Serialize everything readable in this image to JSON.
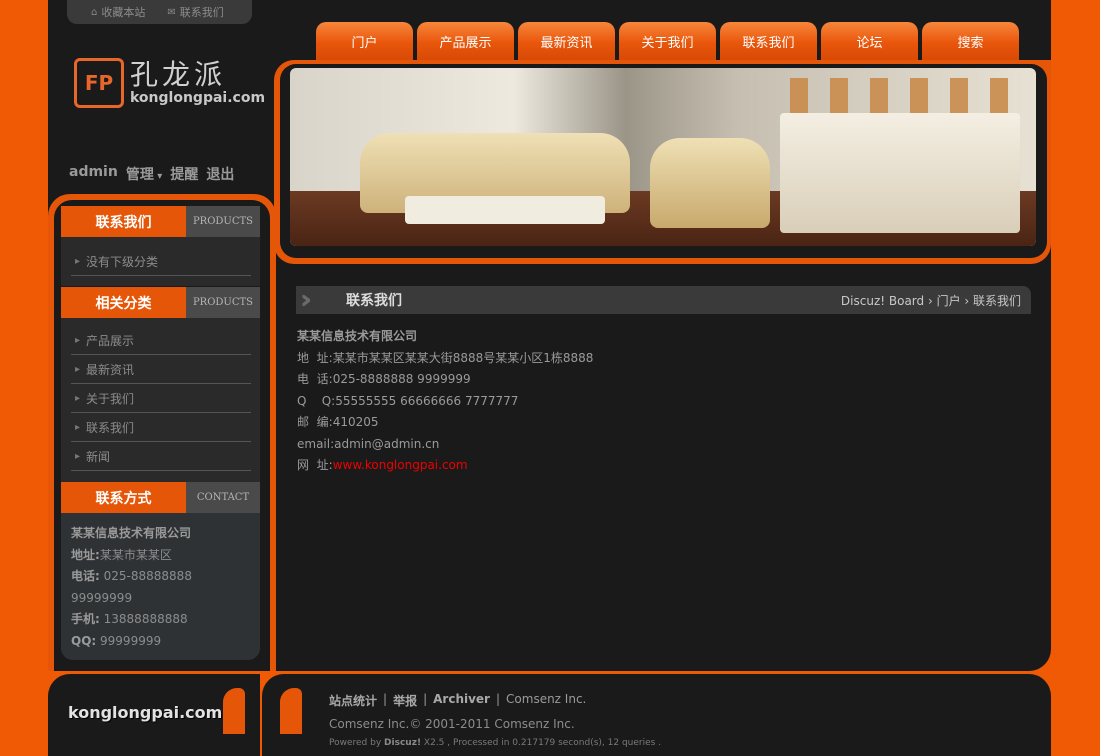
{
  "top_links": [
    {
      "icon": "home-icon",
      "label": "收藏本站"
    },
    {
      "icon": "mail-icon",
      "label": "联系我们"
    }
  ],
  "logo": {
    "cn": "孔龙派",
    "en": "konglongpai.com",
    "mark": "FP"
  },
  "user": {
    "name": "admin",
    "manage": "管理",
    "remind": "提醒",
    "logout": "退出"
  },
  "nav": [
    "门户",
    "产品展示",
    "最新资讯",
    "关于我们",
    "联系我们",
    "论坛",
    "搜索"
  ],
  "sidebar": {
    "box1": {
      "title": "联系我们",
      "en": "PRODUCTS",
      "items": [
        "没有下级分类"
      ]
    },
    "box2": {
      "title": "相关分类",
      "en": "PRODUCTS",
      "items": [
        "产品展示",
        "最新资讯",
        "关于我们",
        "联系我们",
        "新闻"
      ]
    },
    "box3": {
      "title": "联系方式",
      "en": "CONTACT",
      "company": "某某信息技术有限公司",
      "address_label": "地址:",
      "address": "某某市某某区",
      "phone_label": "电话:",
      "phone": "025-88888888 99999999",
      "mobile_label": "手机:",
      "mobile": "13888888888",
      "qq_label": "QQ:",
      "qq": "99999999"
    }
  },
  "content": {
    "title": "联系我们",
    "breadcrumb": "Discuz! Board › 门户 › 联系我们",
    "company": "某某信息技术有限公司",
    "rows": [
      {
        "label": "地  址:",
        "value": "某某市某某区某某大街8888号某某小区1栋8888"
      },
      {
        "label": "电  话:",
        "value": "025-8888888 9999999"
      },
      {
        "label": "Q    Q:",
        "value": "55555555 66666666 7777777"
      },
      {
        "label": "邮  编:",
        "value": "410205"
      },
      {
        "label": "email:",
        "value": "admin@admin.cn"
      }
    ],
    "web_label": "网  址:",
    "web": "www.konglongpai.com"
  },
  "footer": {
    "logo": "konglongpai.com",
    "links": [
      "站点统计",
      "举报",
      "Archiver",
      "Comsenz Inc."
    ],
    "copyright": "Comsenz Inc.© 2001-2011 Comsenz Inc.",
    "powered_prefix": "Powered by",
    "powered_brand": "Discuz!",
    "powered_rest": "X2.5 , Processed in 0.217179 second(s), 12 queries ."
  },
  "colors": {
    "accent": "#e65609",
    "bg": "#1a1a1a",
    "link_red": "#ee0000"
  }
}
